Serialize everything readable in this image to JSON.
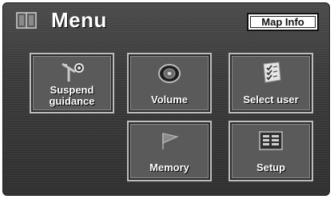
{
  "header": {
    "title": "Menu",
    "map_info_label": "Map Info"
  },
  "tiles": [
    {
      "label_line1": "Suspend",
      "label_line2": "guidance",
      "icon": "suspend-guidance-icon"
    },
    {
      "label": "Volume",
      "icon": "speaker-icon"
    },
    {
      "label": "Select user",
      "icon": "checklist-icon"
    },
    {
      "label": "Memory",
      "icon": "flag-icon"
    },
    {
      "label": "Setup",
      "icon": "setup-list-icon"
    }
  ],
  "colors": {
    "background": "#3b3b3b",
    "tile_border": "#bdbdbd",
    "text": "#ffffff",
    "button_bg": "#ffffff"
  }
}
